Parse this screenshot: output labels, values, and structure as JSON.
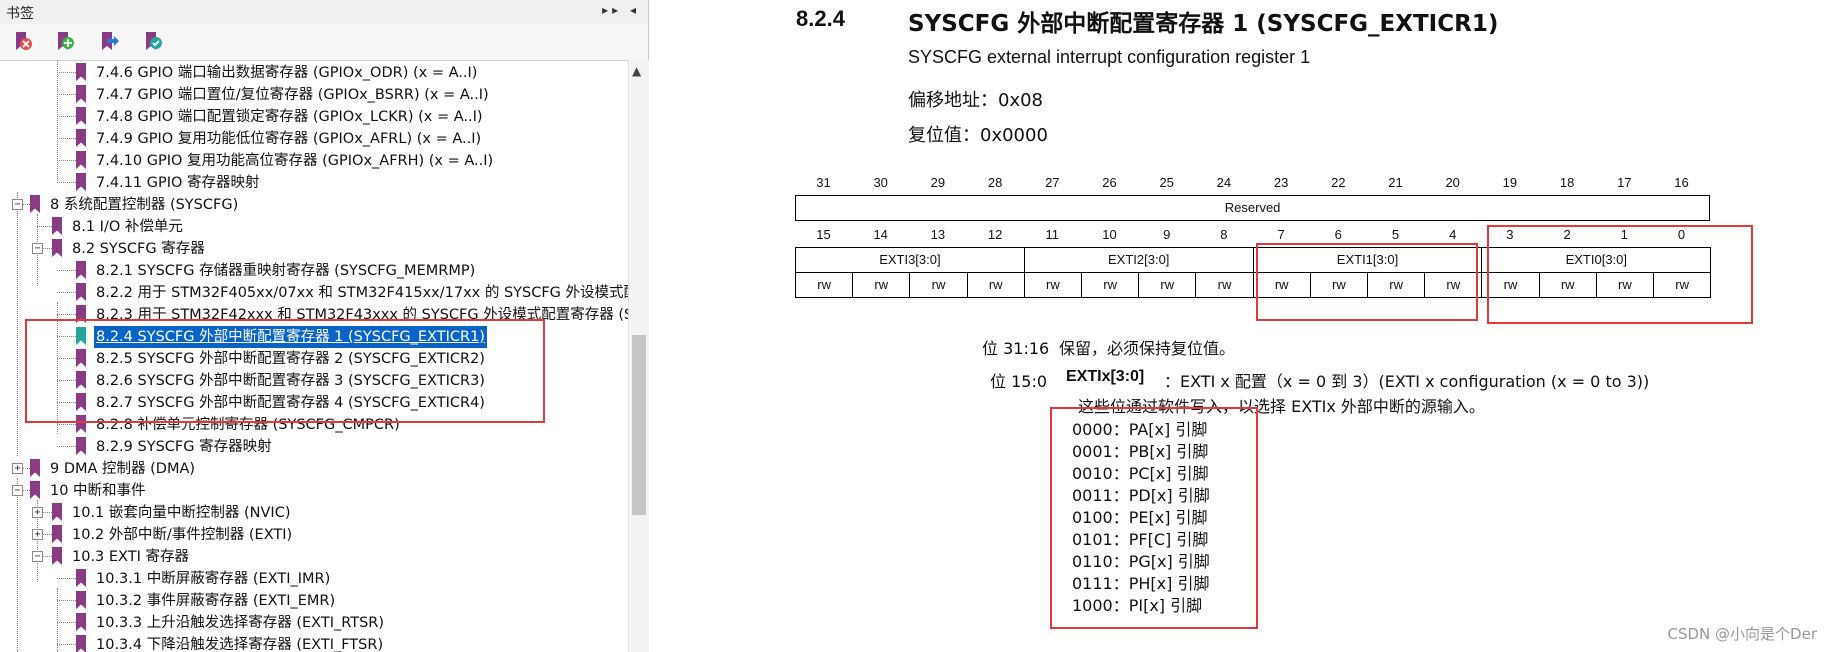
{
  "sidebar": {
    "title": "书签",
    "header_controls": "▸▸ ◂",
    "toolbar": [
      {
        "icon": "delete-bookmark-icon"
      },
      {
        "icon": "add-bookmark-icon"
      },
      {
        "icon": "goto-bookmark-icon"
      },
      {
        "icon": "bookmark-properties-icon"
      }
    ],
    "scroll_up": "▲",
    "items": [
      {
        "label": "7.4.6 GPIO 端口输出数据寄存器 (GPIOx_ODR) (x = A..I)",
        "level": 3,
        "expander": ""
      },
      {
        "label": "7.4.7 GPIO 端口置位/复位寄存器 (GPIOx_BSRR) (x = A..I)",
        "level": 3,
        "expander": ""
      },
      {
        "label": "7.4.8 GPIO 端口配置锁定寄存器 (GPIOx_LCKR) (x = A..I)",
        "level": 3,
        "expander": ""
      },
      {
        "label": "7.4.9 GPIO 复用功能低位寄存器 (GPIOx_AFRL) (x = A..I)",
        "level": 3,
        "expander": ""
      },
      {
        "label": "7.4.10 GPIO 复用功能高位寄存器 (GPIOx_AFRH) (x = A..I)",
        "level": 3,
        "expander": ""
      },
      {
        "label": "7.4.11 GPIO 寄存器映射",
        "level": 3,
        "expander": ""
      },
      {
        "label": "8 系统配置控制器 (SYSCFG)",
        "level": 1,
        "expander": "−"
      },
      {
        "label": "8.1 I/O 补偿单元",
        "level": 2,
        "expander": ""
      },
      {
        "label": "8.2 SYSCFG 寄存器",
        "level": 2,
        "expander": "−"
      },
      {
        "label": "8.2.1 SYSCFG 存储器重映射寄存器 (SYSCFG_MEMRMP)",
        "level": 3,
        "expander": ""
      },
      {
        "label": "8.2.2 用于 STM32F405xx/07xx 和 STM32F415xx/17xx 的 SYSCFG 外设模式配置",
        "level": 3,
        "expander": ""
      },
      {
        "label": "8.2.3 用于 STM32F42xxx 和 STM32F43xxx 的 SYSCFG 外设模式配置寄存器 (S",
        "level": 3,
        "expander": ""
      },
      {
        "label": "8.2.4 SYSCFG 外部中断配置寄存器 1 (SYSCFG_EXTICR1)",
        "level": 3,
        "expander": "",
        "selected": true
      },
      {
        "label": "8.2.5 SYSCFG 外部中断配置寄存器 2 (SYSCFG_EXTICR2)",
        "level": 3,
        "expander": ""
      },
      {
        "label": "8.2.6 SYSCFG 外部中断配置寄存器 3 (SYSCFG_EXTICR3)",
        "level": 3,
        "expander": ""
      },
      {
        "label": "8.2.7 SYSCFG 外部中断配置寄存器 4 (SYSCFG_EXTICR4)",
        "level": 3,
        "expander": ""
      },
      {
        "label": "8.2.8 补偿单元控制寄存器 (SYSCFG_CMPCR)",
        "level": 3,
        "expander": ""
      },
      {
        "label": "8.2.9 SYSCFG 寄存器映射",
        "level": 3,
        "expander": ""
      },
      {
        "label": "9 DMA 控制器 (DMA)",
        "level": 1,
        "expander": "+"
      },
      {
        "label": "10 中断和事件",
        "level": 1,
        "expander": "−"
      },
      {
        "label": "10.1 嵌套向量中断控制器 (NVIC)",
        "level": 2,
        "expander": "+"
      },
      {
        "label": "10.2 外部中断/事件控制器 (EXTI)",
        "level": 2,
        "expander": "+"
      },
      {
        "label": "10.3 EXTI 寄存器",
        "level": 2,
        "expander": "−"
      },
      {
        "label": "10.3.1 中断屏蔽寄存器 (EXTI_IMR)",
        "level": 3,
        "expander": ""
      },
      {
        "label": "10.3.2 事件屏蔽寄存器 (EXTI_EMR)",
        "level": 3,
        "expander": ""
      },
      {
        "label": "10.3.3 上升沿触发选择寄存器 (EXTI_RTSR)",
        "level": 3,
        "expander": ""
      },
      {
        "label": "10.3.4 下降沿触发选择寄存器 (EXTI_FTSR)",
        "level": 3,
        "expander": ""
      }
    ]
  },
  "doc": {
    "section_number": "8.2.4",
    "section_title": "SYSCFG 外部中断配置寄存器 1 (SYSCFG_EXTICR1)",
    "subtitle": "SYSCFG external interrupt configuration register 1",
    "offset": "偏移地址：0x08",
    "reset": "复位值：0x0000",
    "upper_bits": [
      "31",
      "30",
      "29",
      "28",
      "27",
      "26",
      "25",
      "24",
      "23",
      "22",
      "21",
      "20",
      "19",
      "18",
      "17",
      "16"
    ],
    "reserved_label": "Reserved",
    "lower_bits": [
      "15",
      "14",
      "13",
      "12",
      "11",
      "10",
      "9",
      "8",
      "7",
      "6",
      "5",
      "4",
      "3",
      "2",
      "1",
      "0"
    ],
    "fields": [
      "EXTI3[3:0]",
      "EXTI2[3:0]",
      "EXTI1[3:0]",
      "EXTI0[3:0]"
    ],
    "access": [
      "rw",
      "rw",
      "rw",
      "rw",
      "rw",
      "rw",
      "rw",
      "rw",
      "rw",
      "rw",
      "rw",
      "rw",
      "rw",
      "rw",
      "rw",
      "rw"
    ],
    "bit31_16_label": "位 31:16",
    "bit31_16_desc": "保留，必须保持复位值。",
    "bit15_0_label": "位 15:0",
    "bit15_0_name": "EXTIx[3:0]",
    "bit15_0_desc": "：EXTI x 配置（x = 0 到 3）(EXTI x configuration (x = 0 to 3))",
    "bit15_0_note": "这些位通过软件写入，以选择 EXTIx 外部中断的源输入。",
    "options": [
      "0000：PA[x] 引脚",
      "0001：PB[x] 引脚",
      "0010：PC[x] 引脚",
      "0011：PD[x] 引脚",
      "0100：PE[x] 引脚",
      "0101：PF[C] 引脚",
      "0110：PG[x] 引脚",
      "0111：PH[x] 引脚",
      "1000：PI[x] 引脚"
    ]
  },
  "watermark": "CSDN @小向是个Der",
  "colors": {
    "annotation_red": "#e03a3a",
    "bookmark": "#8b3a84",
    "selection": "#0a64c8"
  }
}
